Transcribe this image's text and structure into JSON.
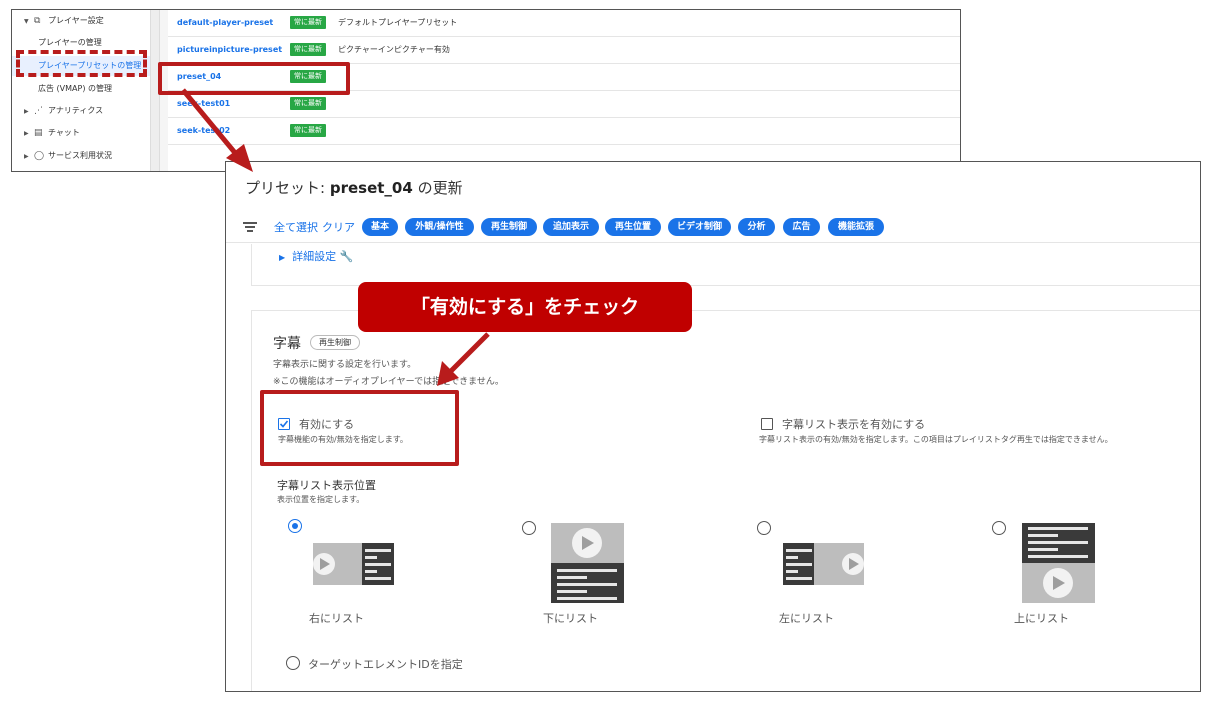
{
  "sidebar": {
    "player_settings": "プレイヤー設定",
    "player_manage": "プレイヤーの管理",
    "preset_manage": "プレイヤープリセットの管理",
    "ad_manage": "広告 (VMAP) の管理",
    "analytics": "アナリティクス",
    "chat": "チャット",
    "service_status": "サービス利用状況"
  },
  "presets": [
    {
      "name": "default-player-preset",
      "badge": "常に最新",
      "desc": "デフォルトプレイヤープリセット"
    },
    {
      "name": "pictureinpicture-preset",
      "badge": "常に最新",
      "desc": "ピクチャーインピクチャー有効"
    },
    {
      "name": "preset_04",
      "badge": "常に最新",
      "desc": ""
    },
    {
      "name": "seek-test01",
      "badge": "常に最新",
      "desc": ""
    },
    {
      "name": "seek-test02",
      "badge": "常に最新",
      "desc": ""
    }
  ],
  "main": {
    "title_prefix": "プリセット: ",
    "title_name": "preset_04",
    "title_suffix": " の更新",
    "select_all": "全て選択",
    "clear": "クリア",
    "chips": [
      "基本",
      "外観/操作性",
      "再生制御",
      "追加表示",
      "再生位置",
      "ビデオ制御",
      "分析",
      "広告",
      "機能拡張"
    ],
    "advanced": "詳細設定"
  },
  "subtitle": {
    "title": "字幕",
    "badge": "再生制御",
    "desc1": "字幕表示に関する設定を行います。",
    "desc2": "※この機能はオーディオプレイヤーでは指定できません。",
    "enable_label": "有効にする",
    "enable_help": "字幕機能の有効/無効を指定します。",
    "enable_checked": true,
    "list_label": "字幕リスト表示を有効にする",
    "list_help": "字幕リスト表示の有効/無効を指定します。この項目はプレイリストタグ再生では指定できません。",
    "list_checked": false,
    "position_title": "字幕リスト表示位置",
    "position_desc": "表示位置を指定します。",
    "positions": [
      "右にリスト",
      "下にリスト",
      "左にリスト",
      "上にリスト"
    ],
    "selected_position": "右にリスト",
    "target_option": "ターゲットエレメントIDを指定"
  },
  "annotation": {
    "callout": "「有効にする」をチェック",
    "color": "#c00000"
  }
}
